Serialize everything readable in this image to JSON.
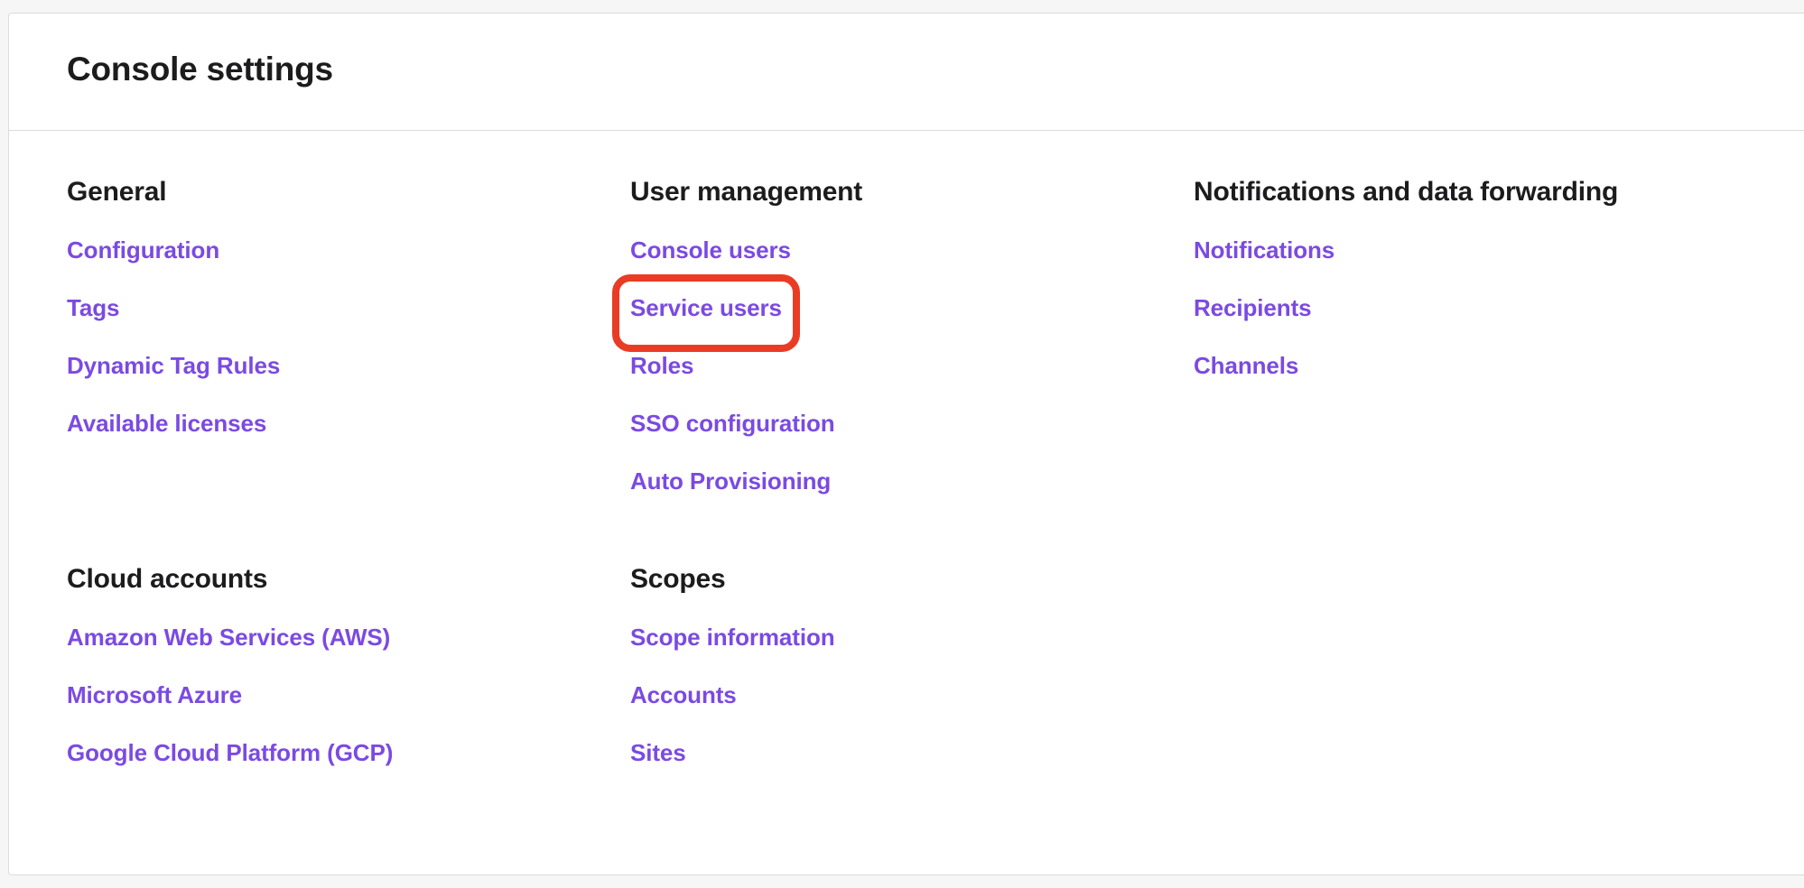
{
  "header": {
    "title": "Console settings"
  },
  "sections": {
    "general": {
      "title": "General",
      "links": [
        "Configuration",
        "Tags",
        "Dynamic Tag Rules",
        "Available licenses"
      ]
    },
    "user_management": {
      "title": "User management",
      "links": [
        "Console users",
        "Service users",
        "Roles",
        "SSO configuration",
        "Auto Provisioning"
      ]
    },
    "notifications": {
      "title": "Notifications and data forwarding",
      "links": [
        "Notifications",
        "Recipients",
        "Channels"
      ]
    },
    "cloud_accounts": {
      "title": "Cloud accounts",
      "links": [
        "Amazon Web Services (AWS)",
        "Microsoft Azure",
        "Google Cloud Platform (GCP)"
      ]
    },
    "scopes": {
      "title": "Scopes",
      "links": [
        "Scope information",
        "Accounts",
        "Sites"
      ]
    }
  },
  "colors": {
    "link": "#7b4ae2",
    "heading": "#1c1c1e",
    "highlight": "#ea3c25"
  }
}
